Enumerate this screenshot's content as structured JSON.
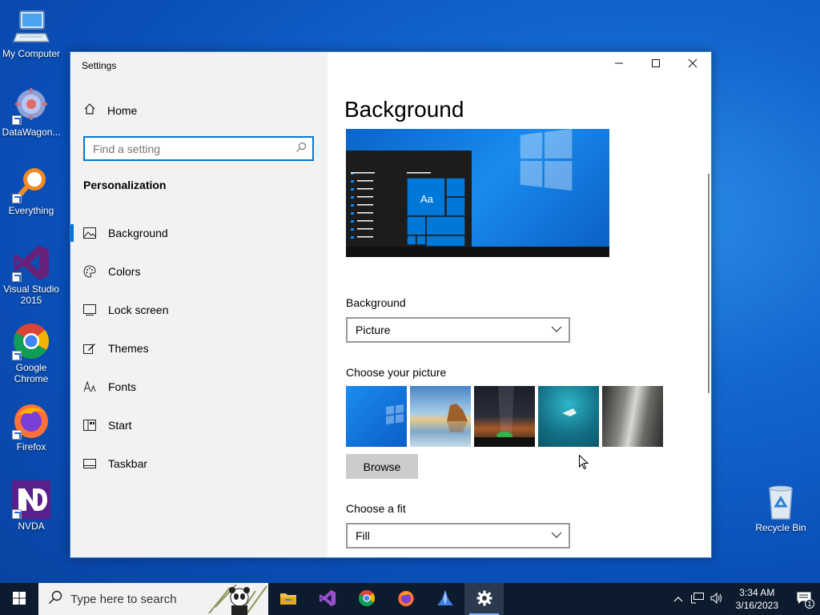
{
  "desktop": {
    "icons": [
      {
        "label": "My Computer",
        "icon": "computer-icon"
      },
      {
        "label": "DataWagon...",
        "icon": "datawagon-icon"
      },
      {
        "label": "Everything",
        "icon": "everything-search-icon"
      },
      {
        "label": "Visual Studio 2015",
        "icon": "visual-studio-icon"
      },
      {
        "label": "Google Chrome",
        "icon": "chrome-icon"
      },
      {
        "label": "Firefox",
        "icon": "firefox-icon"
      },
      {
        "label": "NVDA",
        "icon": "nvda-icon"
      }
    ],
    "recycle_bin": {
      "label": "Recycle Bin",
      "icon": "recycle-bin-icon"
    }
  },
  "window": {
    "title": "Settings",
    "controls": {
      "minimize": "minimize-icon",
      "maximize": "maximize-icon",
      "close": "close-icon"
    }
  },
  "sidebar": {
    "home": "Home",
    "search_placeholder": "Find a setting",
    "section": "Personalization",
    "items": [
      {
        "label": "Background",
        "icon": "image-icon",
        "active": true
      },
      {
        "label": "Colors",
        "icon": "palette-icon",
        "active": false
      },
      {
        "label": "Lock screen",
        "icon": "lock-screen-icon",
        "active": false
      },
      {
        "label": "Themes",
        "icon": "brush-icon",
        "active": false
      },
      {
        "label": "Fonts",
        "icon": "font-icon",
        "active": false
      },
      {
        "label": "Start",
        "icon": "start-icon",
        "active": false
      },
      {
        "label": "Taskbar",
        "icon": "taskbar-icon",
        "active": false
      }
    ]
  },
  "main": {
    "title": "Background",
    "preview_text": "Aa",
    "background_label": "Background",
    "background_value": "Picture",
    "choose_picture_label": "Choose your picture",
    "browse_label": "Browse",
    "fit_label": "Choose a fit",
    "fit_value": "Fill"
  },
  "taskbar": {
    "search_placeholder": "Type here to search",
    "apps": [
      "file-explorer-icon",
      "visual-studio-icon",
      "chrome-icon",
      "firefox-icon",
      "app-icon",
      "settings-icon"
    ],
    "time": "3:34 AM",
    "date": "3/16/2023",
    "notification_count": "1"
  },
  "colors": {
    "accent": "#0078d7",
    "taskbar": "#0d1b2e"
  }
}
